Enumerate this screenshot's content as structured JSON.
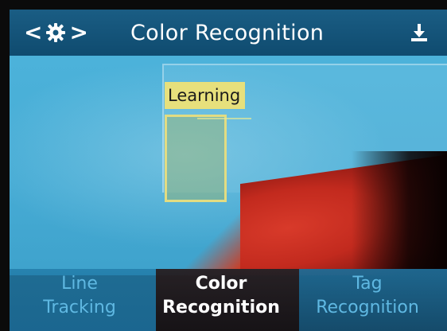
{
  "header": {
    "title": "Color Recognition",
    "nav_prev_glyph": "<",
    "nav_next_glyph": ">",
    "settings_icon": "gear-icon",
    "download_icon": "download-icon"
  },
  "camera_view": {
    "learning_label": "Learning"
  },
  "tabs": [
    {
      "line1": "Line",
      "line2": "Tracking",
      "active": false
    },
    {
      "line1": "Color",
      "line2": "Recognition",
      "active": true
    },
    {
      "line1": "Tag",
      "line2": "Recognition",
      "active": false
    }
  ],
  "colors": {
    "header_bg": "#0f4b6f",
    "view_bg": "#41a9d3",
    "learning_highlight": "#e7e07c",
    "active_tab_text": "#ffffff",
    "inactive_tab_text": "#5fb8e2"
  }
}
